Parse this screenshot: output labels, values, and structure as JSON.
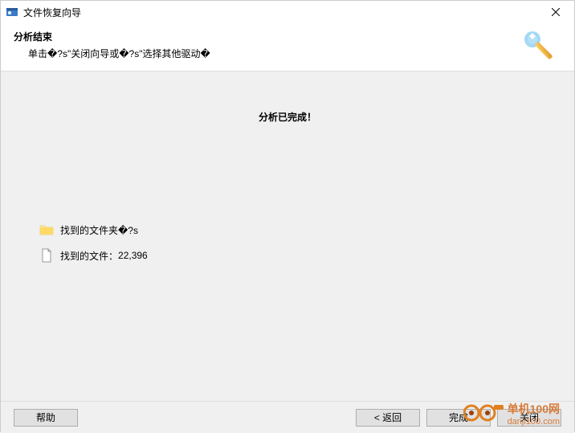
{
  "window": {
    "title": "文件恢复向导"
  },
  "header": {
    "heading": "分析结束",
    "subheading": "单击�?s\"关闭向导或�?s\"选择其他驱动�"
  },
  "content": {
    "completeMessage": "分析已完成！",
    "foundFoldersLabel": "找到的文件夹�?s",
    "foundFilesLabel": "找到的文件：",
    "foundFilesCount": "22,396"
  },
  "footer": {
    "helpLabel": "帮助",
    "backLabel": "< 返回",
    "finishLabel": "完成",
    "closeLabel": "关闭"
  },
  "watermark": {
    "line1": "单机100网",
    "line2": "danji100.com"
  }
}
